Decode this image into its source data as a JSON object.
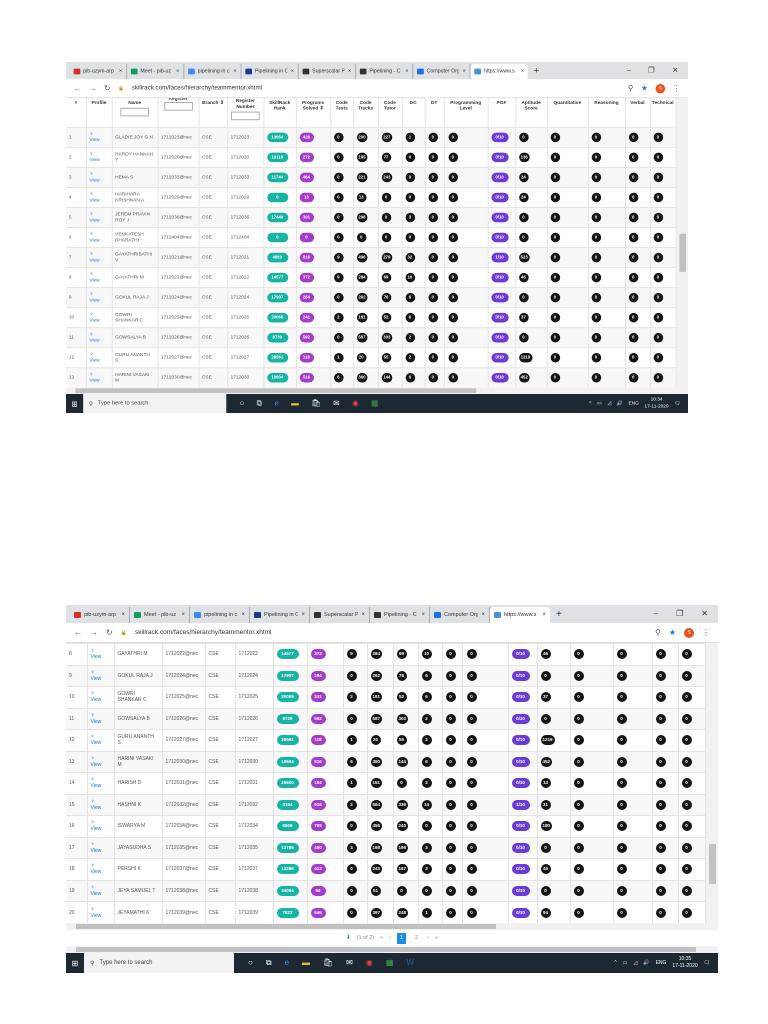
{
  "browser": {
    "tabs": [
      "pib-uzym-arp",
      "Meet - pib-uz",
      "pipelining in c",
      "Pipelining in C",
      "Superscalar P",
      "Pipelining - C",
      "Computer Org",
      "https://www.s"
    ],
    "tab_colors": [
      "#d93025",
      "#0f9d58",
      "#4285f4",
      "#1a3a8a",
      "#333333",
      "#333333",
      "#1a73e8",
      "#4a90d9"
    ],
    "active_tab": 7,
    "new_tab": "+",
    "url": "skillrack.com/faces/hierarchy/teammentor.xhtml",
    "avatar_letter": "S"
  },
  "columns": [
    "#",
    "Profile",
    "Name",
    "Register",
    "Branch ⇕",
    "Register Number",
    "SkillRack Rank",
    "Programs Solved ⇕",
    "Code Tests",
    "Code Tracks",
    "Code Tutor",
    "DC",
    "DT",
    "Programming Level",
    "PGF",
    "Aptitude Score",
    "Quantitative",
    "Reasoning",
    "Verbal",
    "Technical"
  ],
  "view_label": "View",
  "students": [
    [
      "1",
      "GLADIE JOY G N",
      "1712023@nec",
      "CSE",
      "1712023",
      "13054",
      "428",
      "0",
      "200",
      "227",
      "1",
      "0",
      "0",
      "0/10",
      "0",
      "0",
      "0",
      "0",
      "0"
    ],
    [
      "2",
      "HARDY HANNAH Y",
      "1712020@nec",
      "CSE",
      "1712020",
      "19119",
      "272",
      "0",
      "195",
      "77",
      "0",
      "0",
      "0",
      "0/10",
      "136",
      "0",
      "0",
      "0",
      "0"
    ],
    [
      "3",
      "HEMA S",
      "1712033@nec",
      "CSE",
      "1712033",
      "11744",
      "464",
      "0",
      "221",
      "243",
      "0",
      "0",
      "0",
      "0/10",
      "24",
      "0",
      "0",
      "0",
      "0"
    ],
    [
      "4",
      "HARIHARA KRISHNAN A",
      "1712029@nec",
      "CSE",
      "1712029",
      "0",
      "13",
      "0",
      "13",
      "0",
      "0",
      "0",
      "0",
      "0/10",
      "24",
      "0",
      "0",
      "0",
      "0"
    ],
    [
      "5",
      "JEREM PRAVIN ROY J",
      "1712036@nec",
      "CSE",
      "1712036",
      "17449",
      "301",
      "0",
      "298",
      "0",
      "3",
      "0",
      "0",
      "0/10",
      "0",
      "0",
      "0",
      "0",
      "0"
    ],
    [
      "6",
      "VENKATESH BHARATHI",
      "1712404@nec",
      "CSE",
      "1712404",
      "0",
      "0",
      "0",
      "0",
      "0",
      "0",
      "0",
      "0",
      "0/10",
      "0",
      "0",
      "0",
      "0",
      "0"
    ],
    [
      "7",
      "GAYATHRIBATHI V",
      "1712021@nec",
      "CSE",
      "1712021",
      "4869",
      "816",
      "9",
      "496",
      "279",
      "32",
      "0",
      "0",
      "1/10",
      "523",
      "0",
      "0",
      "0",
      "0"
    ],
    [
      "8",
      "GAYATHRI M",
      "1712022@nec",
      "CSE",
      "1712022",
      "14577",
      "372",
      "9",
      "284",
      "69",
      "10",
      "0",
      "0",
      "0/10",
      "46",
      "0",
      "0",
      "0",
      "0"
    ],
    [
      "9",
      "GOKUL RAJA J",
      "1712024@nec",
      "CSE",
      "1712024",
      "17907",
      "284",
      "0",
      "262",
      "76",
      "6",
      "0",
      "0",
      "0/10",
      "0",
      "0",
      "0",
      "0",
      "0"
    ],
    [
      "10",
      "GOWRI SHANKAR C",
      "1712025@nec",
      "CSE",
      "1712025",
      "20065",
      "241",
      "2",
      "181",
      "52",
      "6",
      "0",
      "0",
      "0/10",
      "37",
      "0",
      "0",
      "0",
      "0"
    ],
    [
      "11",
      "GOWSALYA B",
      "1712026@nec",
      "CSE",
      "1712026",
      "8739",
      "592",
      "0",
      "587",
      "303",
      "2",
      "0",
      "0",
      "0/10",
      "0",
      "0",
      "0",
      "0",
      "0"
    ],
    [
      "12",
      "GURU ANANTH S",
      "1712027@nec",
      "CSE",
      "1712027",
      "28561",
      "118",
      "1",
      "20",
      "55",
      "2",
      "0",
      "0",
      "0/10",
      "1219",
      "0",
      "0",
      "0",
      "0"
    ],
    [
      "13",
      "HARINI VASAKI M",
      "1712030@nec",
      "CSE",
      "1712030",
      "10604",
      "516",
      "6",
      "360",
      "144",
      "6",
      "0",
      "0",
      "0/10",
      "452",
      "0",
      "0",
      "0",
      "0"
    ],
    [
      "14",
      "HARISH D",
      "1712031@nec",
      "CSE",
      "1712031",
      "25500",
      "154",
      "1",
      "151",
      "0",
      "2",
      "0",
      "0",
      "0/10",
      "13",
      "0",
      "0",
      "0",
      "0"
    ],
    [
      "15",
      "HASHNI K",
      "1712032@nec",
      "CSE",
      "1712032",
      "4154",
      "916",
      "2",
      "564",
      "336",
      "14",
      "0",
      "0",
      "1/10",
      "31",
      "0",
      "0",
      "0",
      "0"
    ],
    [
      "16",
      "ISWARYA M",
      "1712034@nec",
      "CSE",
      "1712034",
      "6509",
      "705",
      "0",
      "456",
      "240",
      "0",
      "0",
      "0",
      "0/10",
      "180",
      "0",
      "0",
      "0",
      "0"
    ],
    [
      "17",
      "JAYASUDHA S",
      "1712035@nec",
      "CSE",
      "1712035",
      "13786",
      "400",
      "3",
      "198",
      "196",
      "3",
      "0",
      "0",
      "0/10",
      "0",
      "0",
      "0",
      "0",
      "0"
    ],
    [
      "18",
      "PERSHI K",
      "1712037@nec",
      "CSE",
      "1712037",
      "13266",
      "413",
      "0",
      "243",
      "167",
      "3",
      "0",
      "0",
      "0/10",
      "45",
      "0",
      "0",
      "0",
      "0"
    ],
    [
      "19",
      "JEYA SAMUEL T",
      "1712038@nec",
      "CSE",
      "1712038",
      "34094",
      "56",
      "0",
      "51",
      "0",
      "0",
      "0",
      "0",
      "0/10",
      "0",
      "0",
      "0",
      "0",
      "0"
    ],
    [
      "20",
      "JEYAMATHI K",
      "1712039@nec",
      "CSE",
      "1712039",
      "7622",
      "646",
      "0",
      "397",
      "248",
      "1",
      "0",
      "0",
      "0/10",
      "94",
      "0",
      "0",
      "0",
      "0"
    ]
  ],
  "screenshots": [
    {
      "first_row": 1,
      "last_row": 13,
      "show_header": true,
      "show_pager": false,
      "clock_time": "10:34",
      "clock_date": "17-11-2020",
      "vertical_scroll_position": 0.55
    },
    {
      "first_row": 8,
      "last_row": 20,
      "show_header": false,
      "show_pager": true,
      "clock_time": "10:35",
      "clock_date": "17-11-2020",
      "vertical_scroll_position": 0.85
    }
  ],
  "pager": {
    "summary": "(1 of 2)",
    "first": "«",
    "prev": "‹",
    "pages": [
      "1",
      "2"
    ],
    "current_page": "1",
    "next": "›",
    "last": "»"
  },
  "taskbar": {
    "search_placeholder": "Type here to search",
    "language": "ENG"
  },
  "colors": {
    "rank": "#17b3a3",
    "programs": "#a33ccc",
    "pgf": "#6b3bd8",
    "count": "#151515"
  }
}
